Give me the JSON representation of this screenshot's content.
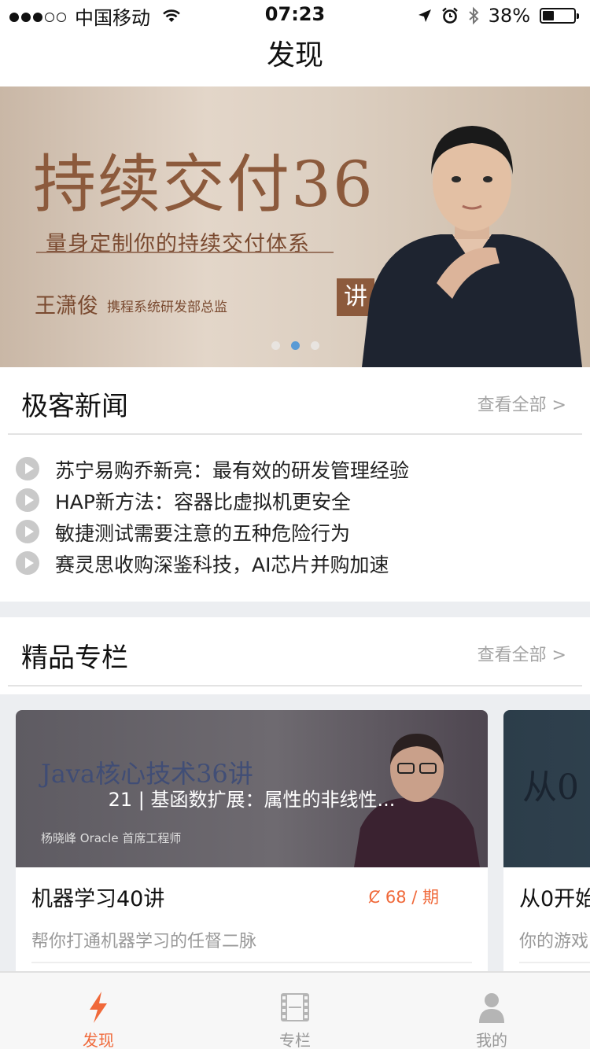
{
  "status_bar": {
    "carrier": "中国移动",
    "time": "07:23",
    "battery": "38%",
    "battery_level": 0.38,
    "signal_bars": 3
  },
  "nav": {
    "title": "发现"
  },
  "banner": {
    "title": "持续交付36",
    "badge": "讲",
    "subtitle": "量身定制你的持续交付体系",
    "author": "王潇俊",
    "role": "携程系统研发部总监",
    "active_index": 1,
    "page_count": 3
  },
  "news": {
    "title": "极客新闻",
    "view_all": "查看全部 >",
    "items": [
      "苏宁易购乔新亮：最有效的研发管理经验",
      "HAP新方法：容器比虚拟机更安全",
      "敏捷测试需要注意的五种危险行为",
      "赛灵思收购深鉴科技，AI芯片并购加速"
    ]
  },
  "columns": {
    "title": "精品专栏",
    "view_all": "查看全部 >",
    "cards": [
      {
        "cover_title": "Java核心技术36讲",
        "cover_author": "杨晓峰 Oracle 首席工程师",
        "lesson": "21 | 基函数扩展：属性的非线性...",
        "name": "机器学习40讲",
        "price": "Ȼ 68 / 期",
        "desc": "帮你打通机器学习的任督二脉"
      },
      {
        "cover_title": "从0",
        "name": "从0开始",
        "desc": "你的游戏"
      }
    ]
  },
  "tab_bar": {
    "tabs": [
      {
        "label": "发现",
        "icon": "lightning-icon",
        "active": true
      },
      {
        "label": "专栏",
        "icon": "film-icon",
        "active": false
      },
      {
        "label": "我的",
        "icon": "person-icon",
        "active": false
      }
    ],
    "accent": "#f0693a",
    "inactive": "#999999"
  }
}
